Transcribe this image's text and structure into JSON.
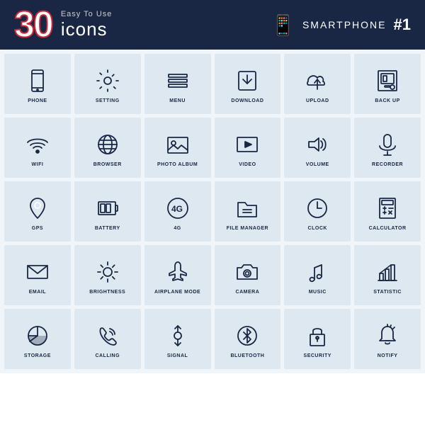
{
  "header": {
    "number": "30",
    "easy_text": "Easy To Use",
    "icons_text": "icons",
    "brand": "SMARTPHONE",
    "brand_num": "#1"
  },
  "icons": [
    {
      "label": "PHONE"
    },
    {
      "label": "SETTING"
    },
    {
      "label": "MENU"
    },
    {
      "label": "DOWNLOAD"
    },
    {
      "label": "UPLOAD"
    },
    {
      "label": "BACK UP"
    },
    {
      "label": "WIFI"
    },
    {
      "label": "BROWSER"
    },
    {
      "label": "PHOTO ALBUM"
    },
    {
      "label": "VIDEO"
    },
    {
      "label": "VOLUME"
    },
    {
      "label": "RECORDER"
    },
    {
      "label": "GPS"
    },
    {
      "label": "BATTERY"
    },
    {
      "label": "4G"
    },
    {
      "label": "FILE MANAGER"
    },
    {
      "label": "CLOCK"
    },
    {
      "label": "CALCULATOR"
    },
    {
      "label": "EMAIL"
    },
    {
      "label": "BRIGHTNESS"
    },
    {
      "label": "AIRPLANE MODE"
    },
    {
      "label": "CAMERA"
    },
    {
      "label": "MUSIC"
    },
    {
      "label": "STATISTIC"
    },
    {
      "label": "STORAGE"
    },
    {
      "label": "CALLING"
    },
    {
      "label": "SIGNAL"
    },
    {
      "label": "BLUETOOTH"
    },
    {
      "label": "SECURITY"
    },
    {
      "label": "NOTIFY"
    }
  ]
}
